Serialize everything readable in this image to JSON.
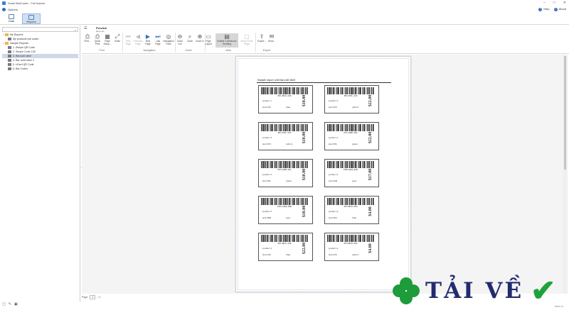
{
  "app": {
    "title": "Smart BarCoder - Full license"
  },
  "options": {
    "label": "Options",
    "help": "Help",
    "about": "About"
  },
  "topnav": {
    "tabs": [
      {
        "label": "Data"
      },
      {
        "label": "Reports"
      }
    ]
  },
  "tree": {
    "search_placeholder": "",
    "items": [
      {
        "label": "My Reports",
        "type": "folder"
      },
      {
        "label": "My products bar codes",
        "type": "doc"
      },
      {
        "label": "Sample Reports",
        "type": "folder"
      },
      {
        "label": "1. Simple QR Code",
        "type": "doc"
      },
      {
        "label": "2. Simple Code 128",
        "type": "doc"
      },
      {
        "label": "3. Barcode label",
        "type": "doc"
      },
      {
        "label": "4. Bar code label 2",
        "type": "doc"
      },
      {
        "label": "5. vCard QR Code",
        "type": "doc"
      },
      {
        "label": "6. Bar Codes",
        "type": "doc"
      }
    ]
  },
  "ribbon": {
    "tab": "Preview",
    "tab_sub": "Barcode...",
    "groups": {
      "print": "Print",
      "navigation": "Navigation",
      "zoom": "Zoom",
      "view": "View",
      "export": "Export"
    },
    "buttons": {
      "print": "Print...",
      "quick_print": "Quick Print",
      "page_setup": "Page Setup...",
      "scale": "Scale",
      "first_page": "First Page",
      "previous_page": "Previous Page",
      "next_page": "Next Page",
      "last_page": "Last Page",
      "navigation_pane": "Navigation Pane",
      "zoom_out": "Zoom Out",
      "zoom": "Zoom",
      "zoom_in": "Zoom In",
      "page_layout": "Page Layout",
      "editing_fields": "Enable Continuous Scrolling",
      "show_cover": "Show Cover Page",
      "export_to": "Export...",
      "send": "Send..."
    }
  },
  "report": {
    "title": "Sample report with barcode label",
    "labels": [
      {
        "code": "P01-BLU-34S",
        "name": "product 1",
        "size": "size:34S",
        "color": "blue",
        "price": "$10.00"
      },
      {
        "code": "P03-YEL-32S",
        "name": "product 2",
        "size": "size:32S",
        "color": "yellow",
        "price": "$22.00"
      },
      {
        "code": "P03-YEL-32S",
        "name": "product 3",
        "size": "size:32S",
        "color": "yellow",
        "price": "$10.00"
      },
      {
        "code": "P07-GRE-30L",
        "name": "product 2",
        "size": "size:30L",
        "color": "green",
        "price": "$22.00"
      },
      {
        "code": "P05-GRE-30L",
        "name": "product 3",
        "size": "size:30L",
        "color": "green",
        "price": "$10.00"
      },
      {
        "code": "P09-GRA-42R",
        "name": "product 2",
        "size": "size:42R",
        "color": "gray",
        "price": "$17.00"
      },
      {
        "code": "P05-GRA-38R",
        "name": "product 3",
        "size": "size:38R",
        "color": "gray",
        "price": "$10.00"
      },
      {
        "code": "P03-BLU-36S",
        "name": "product 4",
        "size": "size:36S",
        "color": "blue",
        "price": "$4.00"
      },
      {
        "code": "P01-BLU-34S",
        "name": "product 2",
        "size": "size:34S",
        "color": "blue",
        "price": "$22.00"
      },
      {
        "code": "P03-BLU-32S",
        "name": "product 4",
        "size": "size:32S",
        "color": "yellow",
        "price": "$4.00"
      }
    ]
  },
  "statusbar": {
    "page_label": "Page",
    "page_value": "1",
    "page_of": "/ 1"
  },
  "watermark": {
    "text": "TẢI VỀ",
    "small": "taive.vn"
  }
}
